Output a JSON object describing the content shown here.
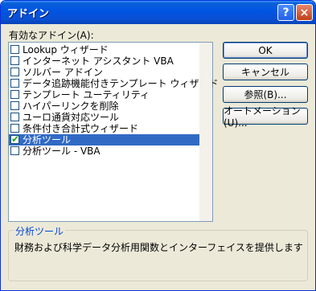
{
  "window": {
    "title": "アドイン"
  },
  "titlebar": {
    "help_glyph": "?",
    "close_glyph": "×"
  },
  "addins": {
    "label": "有効なアドイン(A):",
    "items": [
      {
        "label": "Lookup ウィザード",
        "checked": false
      },
      {
        "label": "インターネット アシスタント VBA",
        "checked": false
      },
      {
        "label": "ソルバー アドイン",
        "checked": false
      },
      {
        "label": "データ追跡機能付きテンプレート ウィザード",
        "checked": false
      },
      {
        "label": "テンプレート ユーティリティ",
        "checked": false
      },
      {
        "label": "ハイパーリンクを削除",
        "checked": false
      },
      {
        "label": "ユーロ通貨対応ツール",
        "checked": false
      },
      {
        "label": "条件付き合計式ウィザード",
        "checked": false
      },
      {
        "label": "分析ツール",
        "checked": true
      },
      {
        "label": "分析ツール - VBA",
        "checked": false
      }
    ],
    "selected_index": 8
  },
  "buttons": {
    "ok": "OK",
    "cancel": "キャンセル",
    "browse": "参照(B)...",
    "automation": "オートメーション(U)..."
  },
  "description": {
    "title": "分析ツール",
    "text": "財務および科学データ分析用関数とインターフェイスを提供します"
  },
  "colors": {
    "title_blue": "#0054e3",
    "selection": "#316ac5",
    "check": "#21a121",
    "group_title": "#0046d5"
  }
}
